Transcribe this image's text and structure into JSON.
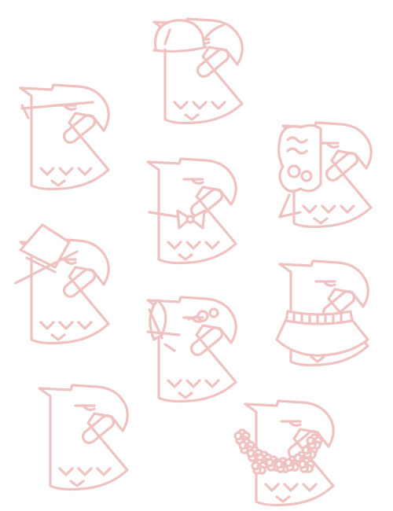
{
  "illustration": {
    "line_color": "#efc1c1",
    "background": "#ffffff",
    "figures": [
      {
        "name": "eagle-with-cap"
      },
      {
        "name": "eagle-with-eyepatch"
      },
      {
        "name": "eagle-with-curly-wig"
      },
      {
        "name": "eagle-with-bowtie"
      },
      {
        "name": "eagle-with-top-hat"
      },
      {
        "name": "eagle-with-turtleneck"
      },
      {
        "name": "eagle-with-quill-and-glasses"
      },
      {
        "name": "eagle-plain"
      },
      {
        "name": "eagle-with-flower-lei"
      }
    ]
  }
}
